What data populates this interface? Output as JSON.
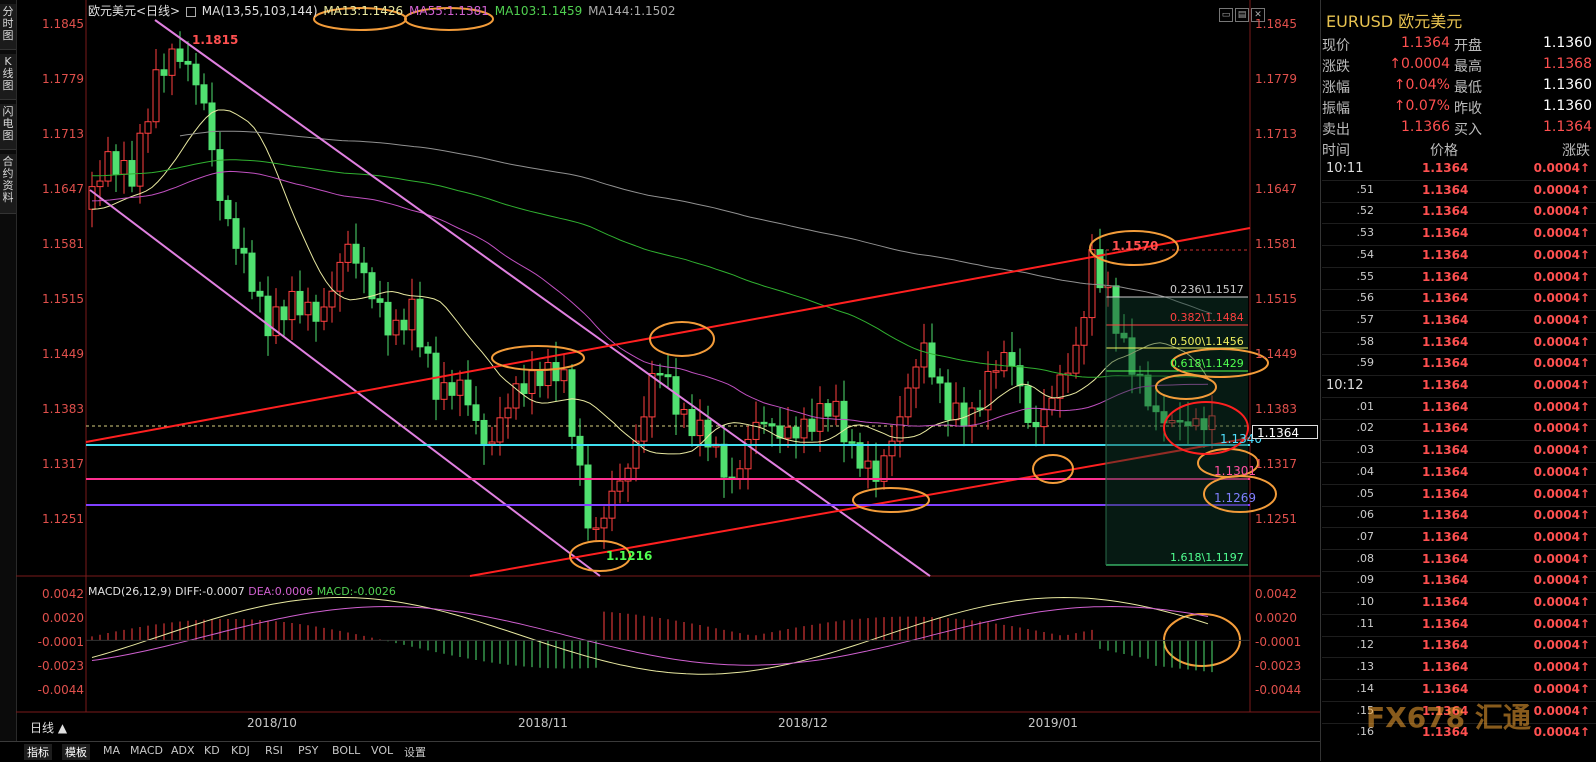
{
  "left_nav": [
    "分时图",
    "K线图",
    "闪电图",
    "合约资料"
  ],
  "header": {
    "symbol": "欧元美元<日线>",
    "ma_params": "MA(13,55,103,144)",
    "ma13": "MA13:1.1426",
    "ma55": "MA55:1.1381",
    "ma103": "MA103:1.1459",
    "ma144": "MA144:1.1502"
  },
  "macd_header": {
    "params": "MACD(26,12,9)",
    "diff": "DIFF:-0.0007",
    "dea": "DEA:0.0006",
    "macd": "MACD:-0.0026"
  },
  "price_axis": [
    "1.1845",
    "1.1779",
    "1.1713",
    "1.1647",
    "1.1581",
    "1.1515",
    "1.1449",
    "1.1383",
    "1.1317",
    "1.1251"
  ],
  "macd_axis": [
    "0.0042",
    "0.0020",
    "-0.0001",
    "-0.0023",
    "-0.0044"
  ],
  "date_axis": [
    "2018/10",
    "2018/11",
    "2018/12",
    "2019/01"
  ],
  "annotations": {
    "high": "1.1815",
    "low": "1.1216",
    "high2": "1.1570",
    "support1": "1.1340",
    "support2": "1.1301",
    "support3": "1.1269"
  },
  "fib": [
    {
      "label": "0.236\\1.1517",
      "color": "#cccccc"
    },
    {
      "label": "0.382\\1.1484",
      "color": "#ff4040"
    },
    {
      "label": "0.500\\1.1456",
      "color": "#f0f060"
    },
    {
      "label": "0.618\\1.1429",
      "color": "#50ff50"
    },
    {
      "label": "1.618\\1.1197",
      "color": "#50ff90"
    }
  ],
  "current_price_tag": "1.1364",
  "period_tab": "日线 ▲",
  "indicator_tabs": [
    "指标",
    "模板",
    "MA",
    "MACD",
    "ADX",
    "KD",
    "KDJ",
    "RSI",
    "PSY",
    "BOLL",
    "VOL",
    "设置"
  ],
  "quote": {
    "title": "EURUSD 欧元美元",
    "rows": [
      {
        "l1": "现价",
        "v1": "1.1364",
        "l2": "开盘",
        "v2": "1.1360"
      },
      {
        "l1": "涨跌",
        "v1": "↑0.0004",
        "l2": "最高",
        "v2": "1.1368"
      },
      {
        "l1": "涨幅",
        "v1": "↑0.04%",
        "l2": "最低",
        "v2": "1.1360"
      },
      {
        "l1": "振幅",
        "v1": "↑0.07%",
        "l2": "昨收",
        "v2": "1.1360"
      },
      {
        "l1": "卖出",
        "v1": "1.1366",
        "l2": "买入",
        "v2": "1.1364"
      }
    ],
    "table_head": {
      "time": "时间",
      "price": "价格",
      "change": "涨跌"
    },
    "ticks": [
      {
        "t": "10:11",
        "p": "1.1364",
        "c": "0.0004↑"
      },
      {
        "t": ".51",
        "p": "1.1364",
        "c": "0.0004↑"
      },
      {
        "t": ".52",
        "p": "1.1364",
        "c": "0.0004↑"
      },
      {
        "t": ".53",
        "p": "1.1364",
        "c": "0.0004↑"
      },
      {
        "t": ".54",
        "p": "1.1364",
        "c": "0.0004↑"
      },
      {
        "t": ".55",
        "p": "1.1364",
        "c": "0.0004↑"
      },
      {
        "t": ".56",
        "p": "1.1364",
        "c": "0.0004↑"
      },
      {
        "t": ".57",
        "p": "1.1364",
        "c": "0.0004↑"
      },
      {
        "t": ".58",
        "p": "1.1364",
        "c": "0.0004↑"
      },
      {
        "t": ".59",
        "p": "1.1364",
        "c": "0.0004↑"
      },
      {
        "t": "10:12",
        "p": "1.1364",
        "c": "0.0004↑"
      },
      {
        "t": ".01",
        "p": "1.1364",
        "c": "0.0004↑"
      },
      {
        "t": ".02",
        "p": "1.1364",
        "c": "0.0004↑"
      },
      {
        "t": ".03",
        "p": "1.1364",
        "c": "0.0004↑"
      },
      {
        "t": ".04",
        "p": "1.1364",
        "c": "0.0004↑"
      },
      {
        "t": ".05",
        "p": "1.1364",
        "c": "0.0004↑"
      },
      {
        "t": ".06",
        "p": "1.1364",
        "c": "0.0004↑"
      },
      {
        "t": ".07",
        "p": "1.1364",
        "c": "0.0004↑"
      },
      {
        "t": ".08",
        "p": "1.1364",
        "c": "0.0004↑"
      },
      {
        "t": ".09",
        "p": "1.1364",
        "c": "0.0004↑"
      },
      {
        "t": ".10",
        "p": "1.1364",
        "c": "0.0004↑"
      },
      {
        "t": ".11",
        "p": "1.1364",
        "c": "0.0004↑"
      },
      {
        "t": ".12",
        "p": "1.1364",
        "c": "0.0004↑"
      },
      {
        "t": ".13",
        "p": "1.1364",
        "c": "0.0004↑"
      },
      {
        "t": ".14",
        "p": "1.1364",
        "c": "0.0004↑"
      },
      {
        "t": ".15",
        "p": "1.1364",
        "c": "0.0004↑"
      },
      {
        "t": ".16",
        "p": "1.1364",
        "c": "0.0004↑"
      }
    ]
  },
  "colors": {
    "up": "#ff4040",
    "down": "#50e070",
    "ma13": "#e8e8a0",
    "ma55": "#c050c0",
    "ma103": "#30b030",
    "ma144": "#909090",
    "highlight": "#f39c3a"
  }
}
